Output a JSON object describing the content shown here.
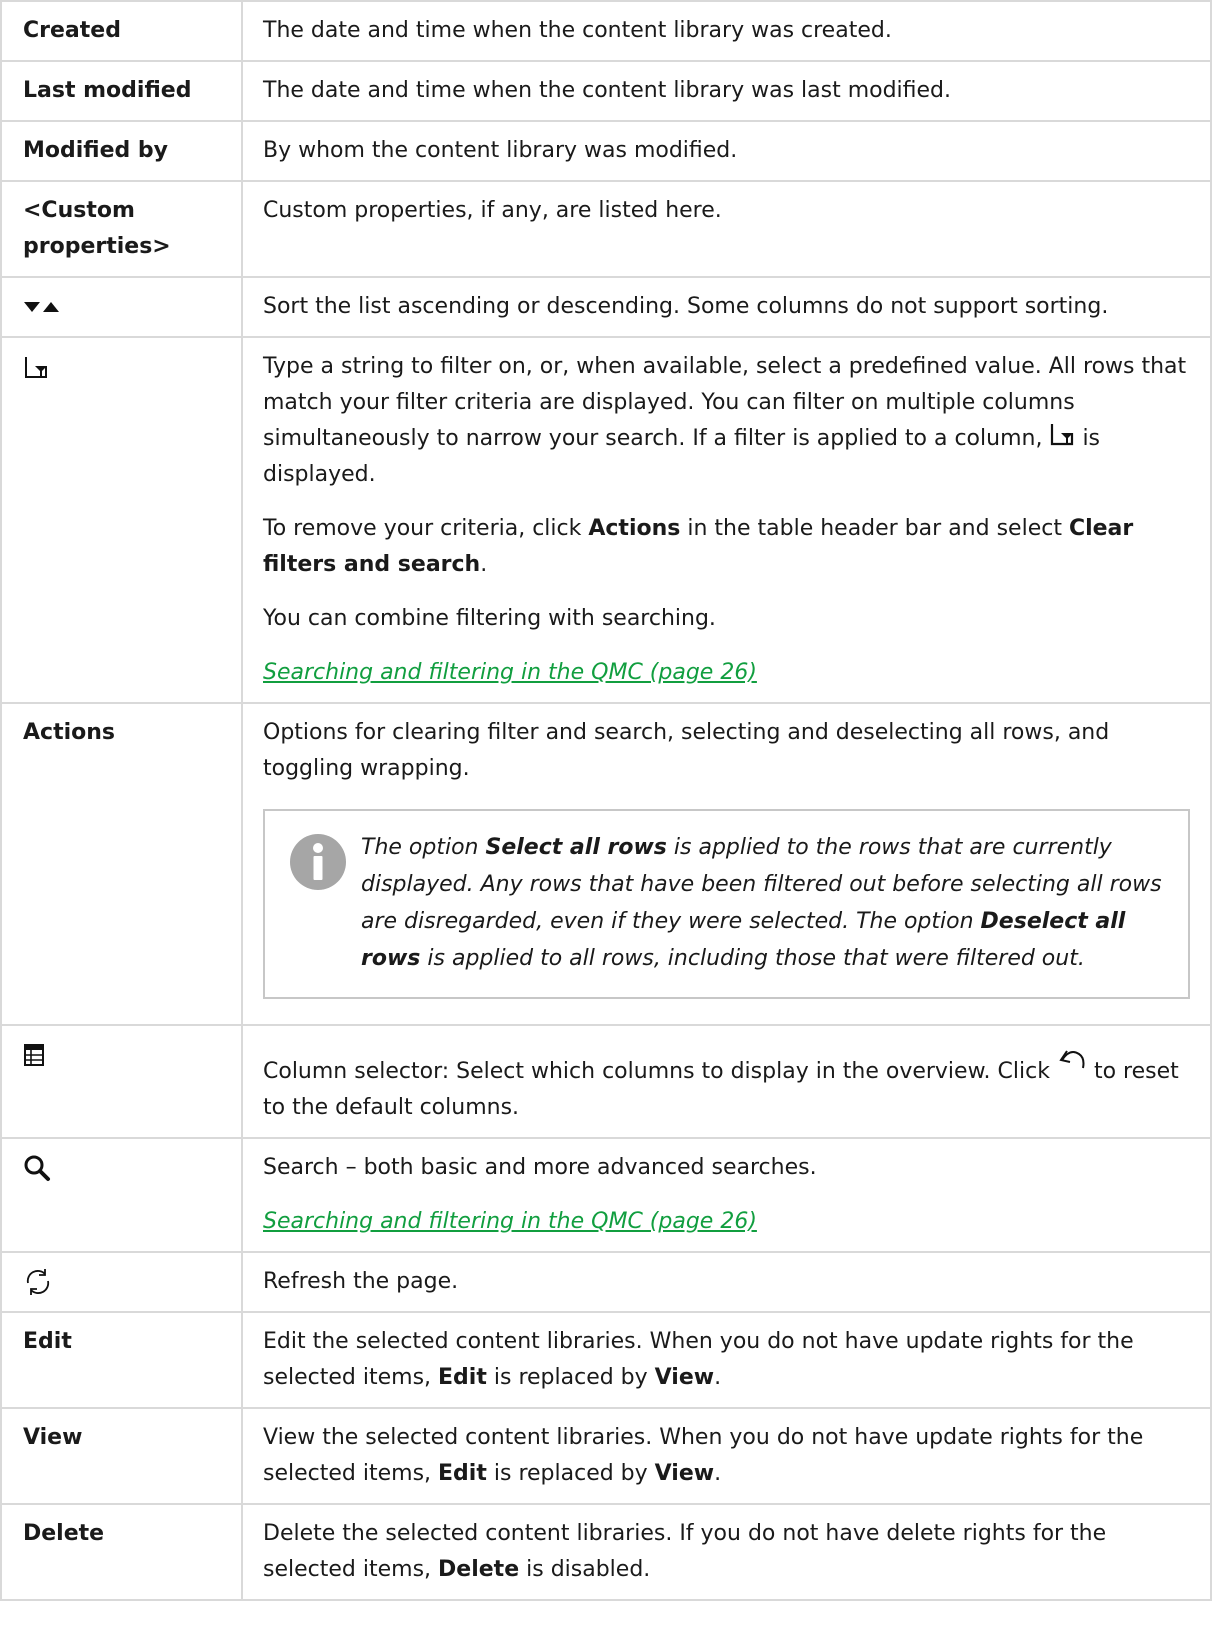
{
  "rows": [
    {
      "term": "Created",
      "desc": "The date and time when the content library was created."
    },
    {
      "term": "Last modified",
      "desc": "The date and time when the content library was last modified."
    },
    {
      "term": "Modified by",
      "desc": "By whom the content library was modified."
    },
    {
      "term": "<Custom properties>",
      "desc": "Custom properties, if any, are listed here."
    }
  ],
  "sort": {
    "icon": "sort-arrows-icon",
    "desc": "Sort the list ascending or descending. Some columns do not support sorting."
  },
  "filter": {
    "icon": "filter-icon",
    "p1_a": "Type a string to filter on, or, when available, select a predefined value. All rows that match your filter criteria are displayed. You can filter on multiple columns simultaneously to narrow your search. If a filter is applied to a column,",
    "p1_b": "is displayed.",
    "p2_a": "To remove your criteria, click",
    "p2_actions": "Actions",
    "p2_b": "in the table header bar and select",
    "p2_clear": "Clear filters and search",
    "p2_c": ".",
    "p3": "You can combine filtering with searching.",
    "link": "Searching and filtering in the QMC (page 26)"
  },
  "actions": {
    "term": "Actions",
    "desc": "Options for clearing filter and search, selecting and deselecting all rows, and toggling wrapping.",
    "note": {
      "icon": "info-icon",
      "t1": "The option",
      "b1": "Select all rows",
      "t2": "is applied to the rows that are currently displayed. Any rows that have been filtered out before selecting all rows are disregarded, even if they were selected. The option",
      "b2": "Deselect all rows",
      "t3": "is applied to all rows, including those that were filtered out."
    }
  },
  "columns": {
    "icon": "column-selector-icon",
    "desc_a": "Column selector: Select which columns to display in the overview. Click",
    "desc_b": "to reset to the default columns.",
    "reset_icon": "reset-arrow-icon"
  },
  "search": {
    "icon": "search-icon",
    "desc": "Search – both basic and more advanced searches.",
    "link": "Searching and filtering in the QMC (page 26)"
  },
  "refresh": {
    "icon": "refresh-icon",
    "desc": "Refresh the page."
  },
  "edit": {
    "term": "Edit",
    "desc_a": "Edit the selected content libraries. When you do not have update rights for the selected items,",
    "b1": "Edit",
    "desc_b": "is replaced by",
    "b2": "View",
    "desc_c": "."
  },
  "view": {
    "term": "View",
    "desc_a": "View the selected content libraries. When you do not have update rights for the selected items,",
    "b1": "Edit",
    "desc_b": "is replaced by",
    "b2": "View",
    "desc_c": "."
  },
  "delete": {
    "term": "Delete",
    "desc_a": "Delete the selected content libraries. If you do not have delete rights for the selected items,",
    "b1": "Delete",
    "desc_b": "is disabled."
  }
}
